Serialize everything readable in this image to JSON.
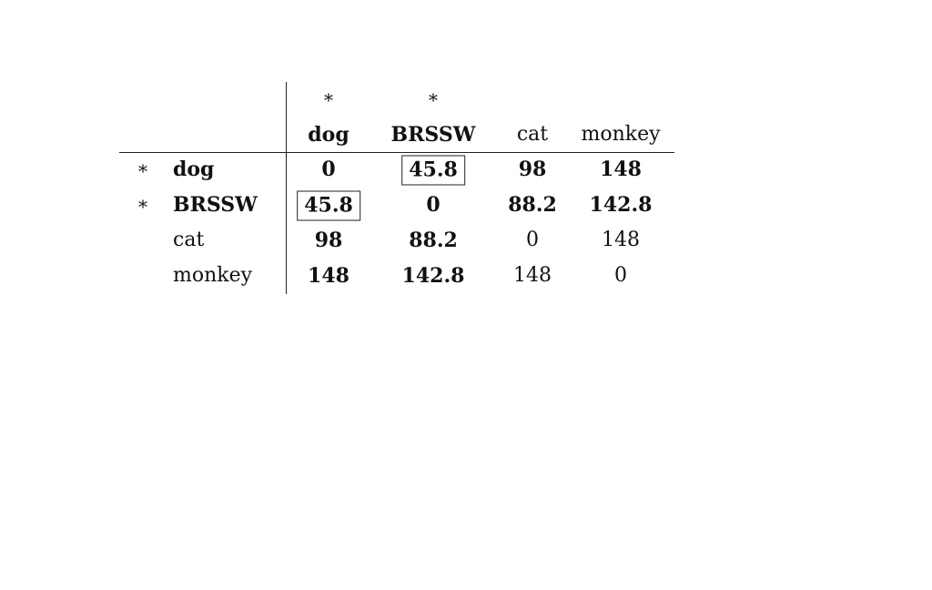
{
  "table": {
    "column_markers": [
      "*",
      "*",
      "",
      ""
    ],
    "column_headers": [
      "dog",
      "BRSSW",
      "cat",
      "monkey"
    ],
    "rows": [
      {
        "marker": "*",
        "label": "dog",
        "values": [
          "0",
          "45.8",
          "98",
          "148"
        ]
      },
      {
        "marker": "*",
        "label": "BRSSW",
        "values": [
          "45.8",
          "0",
          "88.2",
          "142.8"
        ]
      },
      {
        "marker": "",
        "label": "cat",
        "values": [
          "98",
          "88.2",
          "0",
          "148"
        ]
      },
      {
        "marker": "",
        "label": "monkey",
        "values": [
          "148",
          "142.8",
          "148",
          "0"
        ]
      }
    ],
    "bold_columns": [
      "dog",
      "BRSSW"
    ],
    "bold_rows": [
      "dog",
      "BRSSW"
    ],
    "boxed_cells": [
      {
        "row": "dog",
        "column": "BRSSW"
      },
      {
        "row": "BRSSW",
        "column": "dog"
      }
    ]
  }
}
